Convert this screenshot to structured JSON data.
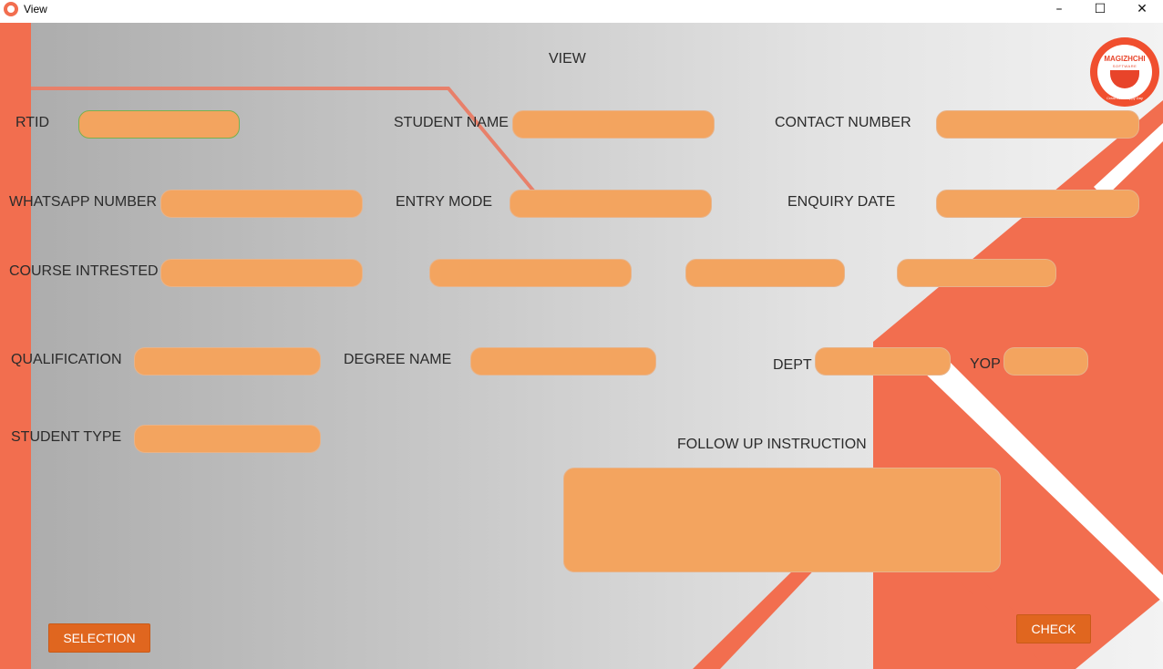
{
  "window": {
    "title": "View",
    "minimize": "–",
    "maximize": "☐",
    "close": "✕"
  },
  "page": {
    "heading": "VIEW"
  },
  "logo": {
    "name": "MAGIZHCHI",
    "subtitle": "SOFTWARE",
    "tagline": "Creat Best Happy Day"
  },
  "form": {
    "rtid": {
      "label": "RTID",
      "value": ""
    },
    "student_name": {
      "label": "STUDENT NAME",
      "value": ""
    },
    "contact_number": {
      "label": "CONTACT NUMBER",
      "value": ""
    },
    "whatsapp_number": {
      "label": "WHATSAPP NUMBER",
      "value": ""
    },
    "entry_mode": {
      "label": "ENTRY MODE",
      "value": ""
    },
    "enquiry_date": {
      "label": "ENQUIRY DATE",
      "value": ""
    },
    "course_interested": {
      "label": "COURSE INTRESTED",
      "values": [
        "",
        "",
        "",
        ""
      ]
    },
    "qualification": {
      "label": "QUALIFICATION",
      "value": ""
    },
    "degree_name": {
      "label": "DEGREE NAME",
      "value": ""
    },
    "dept": {
      "label": "DEPT",
      "value": ""
    },
    "yop": {
      "label": "YOP",
      "value": ""
    },
    "student_type": {
      "label": "STUDENT TYPE",
      "value": ""
    },
    "follow_up_instruction": {
      "label": "FOLLOW UP INSTRUCTION",
      "value": ""
    }
  },
  "buttons": {
    "selection": "SELECTION",
    "check": "CHECK"
  },
  "colors": {
    "accent": "#f26e4f",
    "field": "#f3a45f",
    "button": "#e0661f"
  }
}
